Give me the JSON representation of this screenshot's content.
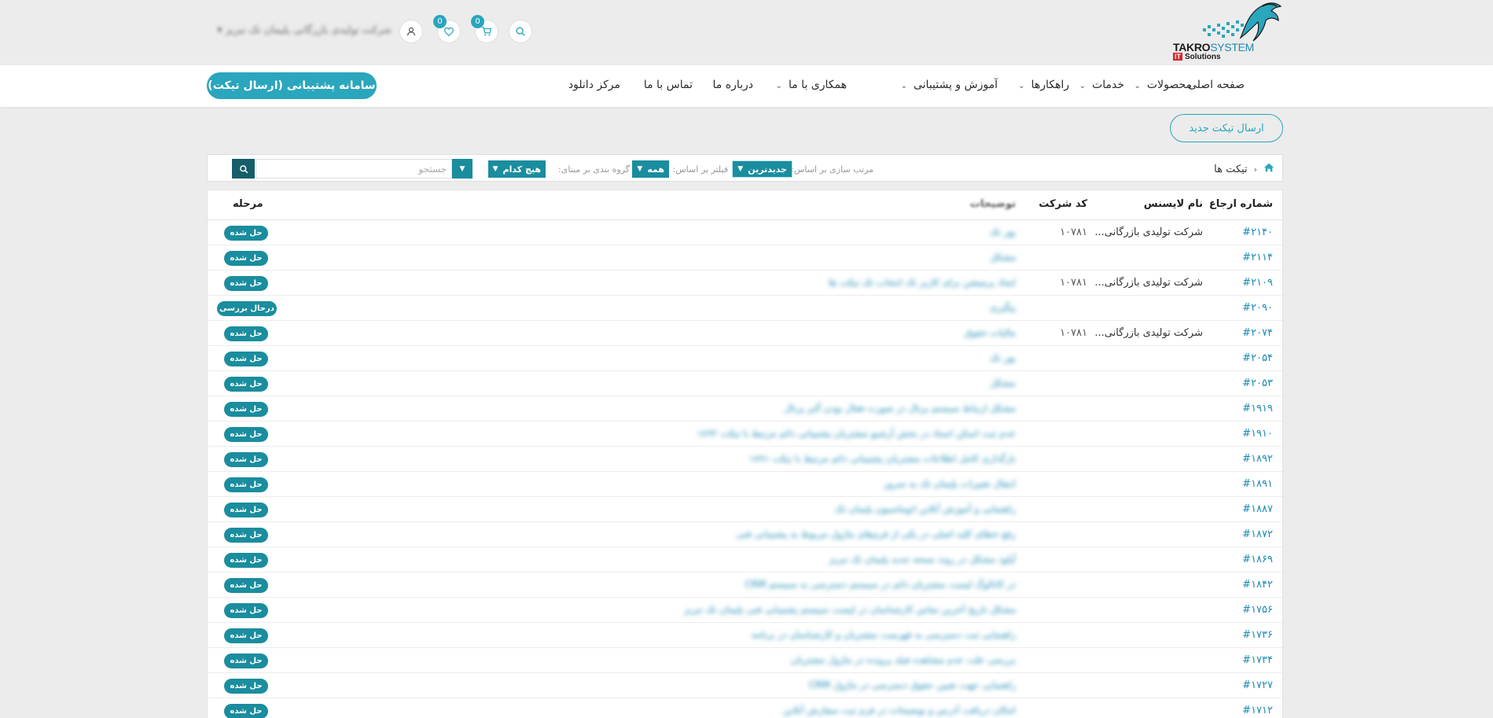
{
  "header": {
    "logo": {
      "brand_bold": "TAKRO",
      "brand_light": "SYSTEM",
      "it_badge": "IT",
      "tagline": "Solutions"
    },
    "cart_count": "0",
    "wishlist_count": "0",
    "user_name": "شرکت تولیدی بازرگانی پلیمان تک تبریز",
    "accent_color": "#2aa6bd"
  },
  "nav": {
    "items": [
      {
        "label": "صفحه اصلی",
        "has_dropdown": false
      },
      {
        "label": "محصولات",
        "has_dropdown": true
      },
      {
        "label": "خدمات",
        "has_dropdown": true
      },
      {
        "label": "راهکارها",
        "has_dropdown": true
      },
      {
        "label": "آموزش و پشتیبانی",
        "has_dropdown": true
      },
      {
        "label": "همکاری با ما",
        "has_dropdown": true
      },
      {
        "label": "درباره ما",
        "has_dropdown": false
      },
      {
        "label": "تماس با ما",
        "has_dropdown": false
      },
      {
        "label": "مرکز دانلود",
        "has_dropdown": false
      }
    ],
    "support_button": "سامانه پشتیبانی (ارسال تیکت)"
  },
  "new_ticket_button": "ارسال تیکت جدید",
  "filterbar": {
    "breadcrumb": "تیکت ها",
    "sort_label": "مرتب سازی بر اساس:",
    "sort_value": "جدیدترین",
    "filter_label": "فیلتر بر اساس:",
    "filter_value": "همه",
    "group_label": "گروه بندی بر مبنای:",
    "group_value": "هیچ کدام",
    "search_placeholder": "جستجو"
  },
  "table": {
    "columns": {
      "ref": "شماره ارجاع",
      "license": "نام لایسنس",
      "code": "کد شرکت",
      "desc": "توضیحات",
      "stage": "مرحله"
    },
    "rows": [
      {
        "ref": "#۲۱۴۰",
        "license": "شرکت تولیدی بازرگانی...",
        "code": "۱۰۷۸۱",
        "desc": "پور تک",
        "status": "حل شده",
        "status_type": "solved"
      },
      {
        "ref": "#۲۱۱۴",
        "license": "",
        "code": "",
        "desc": "مشکل",
        "status": "حل شده",
        "status_type": "solved"
      },
      {
        "ref": "#۲۱۰۹",
        "license": "شرکت تولیدی بازرگانی...",
        "code": "۱۰۷۸۱",
        "desc": "ایجاد پرمیشن برای کاربر تک انتخاب تک تیکت ها",
        "status": "حل شده",
        "status_type": "solved"
      },
      {
        "ref": "#۲۰۹۰",
        "license": "",
        "code": "",
        "desc": "پیگیری",
        "status": "درحال بررسی",
        "status_type": "review"
      },
      {
        "ref": "#۲۰۷۴",
        "license": "شرکت تولیدی بازرگانی...",
        "code": "۱۰۷۸۱",
        "desc": "مالیات حقوق",
        "status": "حل شده",
        "status_type": "solved"
      },
      {
        "ref": "#۲۰۵۴",
        "license": "",
        "code": "",
        "desc": "پور تک",
        "status": "حل شده",
        "status_type": "solved"
      },
      {
        "ref": "#۲۰۵۳",
        "license": "",
        "code": "",
        "desc": "مشکل",
        "status": "حل شده",
        "status_type": "solved"
      },
      {
        "ref": "#۱۹۱۹",
        "license": "",
        "code": "",
        "desc": "مشکل ارتباط سیستم پرتال در صورت فعال بودن آلبر پرتال",
        "status": "حل شده",
        "status_type": "solved"
      },
      {
        "ref": "#۱۹۱۰",
        "license": "",
        "code": "",
        "desc": "عدم ثبت اسکن اسناد در بخش آرشیو مشتریان پشتیبانی دائم مرتبط با تیکت ۱۸۹۲",
        "status": "حل شده",
        "status_type": "solved"
      },
      {
        "ref": "#۱۸۹۲",
        "license": "",
        "code": "",
        "desc": "بارگذاری کامل اطلاعات مشتریان پشتیبانی دائم مرتبط با تیکت ۱۸۹۱",
        "status": "حل شده",
        "status_type": "solved"
      },
      {
        "ref": "#۱۸۹۱",
        "license": "",
        "code": "",
        "desc": "انتقال تغییرات پلیمان تک به سرور",
        "status": "حل شده",
        "status_type": "solved"
      },
      {
        "ref": "#۱۸۸۷",
        "license": "",
        "code": "",
        "desc": "راهنمایی و آموزش آنلاین اتوماسیون پلیمان تک",
        "status": "حل شده",
        "status_type": "solved"
      },
      {
        "ref": "#۱۸۷۲",
        "license": "",
        "code": "",
        "desc": "رفع خطای کلید اصلی در یکی از فرم‌های ماژول مربوط به پشتیبانی فنی",
        "status": "حل شده",
        "status_type": "solved"
      },
      {
        "ref": "#۱۸۶۹",
        "license": "",
        "code": "",
        "desc": "آپلود مشکل در روند نسخه جدید پلیمان تک تبریز",
        "status": "حل شده",
        "status_type": "solved"
      },
      {
        "ref": "#۱۸۴۲",
        "license": "",
        "code": "",
        "desc": "در کاتالوگ لیست مشتریان دائم در سیستم دسترسی به سیستم CRM",
        "status": "حل شده",
        "status_type": "solved"
      },
      {
        "ref": "#۱۷۵۶",
        "license": "",
        "code": "",
        "desc": "مشکل تاریخ آخرین تماس کارشناسان در لیست سیستم پشتیبانی فنی پلیمان تک تبریز",
        "status": "حل شده",
        "status_type": "solved"
      },
      {
        "ref": "#۱۷۳۶",
        "license": "",
        "code": "",
        "desc": "راهنمایی ثبت دسترسی به فهرست مشتریان و کارشناسان در برنامه",
        "status": "حل شده",
        "status_type": "solved"
      },
      {
        "ref": "#۱۷۳۴",
        "license": "",
        "code": "",
        "desc": "بررسی علت عدم مشاهده فیلد پرونده در ماژول مشتریان",
        "status": "حل شده",
        "status_type": "solved"
      },
      {
        "ref": "#۱۷۲۷",
        "license": "",
        "code": "",
        "desc": "راهنمایی جهت تعیین حقوق دسترسی در ماژول CRM",
        "status": "حل شده",
        "status_type": "solved"
      },
      {
        "ref": "#۱۷۱۲",
        "license": "",
        "code": "",
        "desc": "امکان دریافت آدرس و توضیحات در فرم ثبت سفارش آنلاین",
        "status": "حل شده",
        "status_type": "solved"
      }
    ]
  }
}
